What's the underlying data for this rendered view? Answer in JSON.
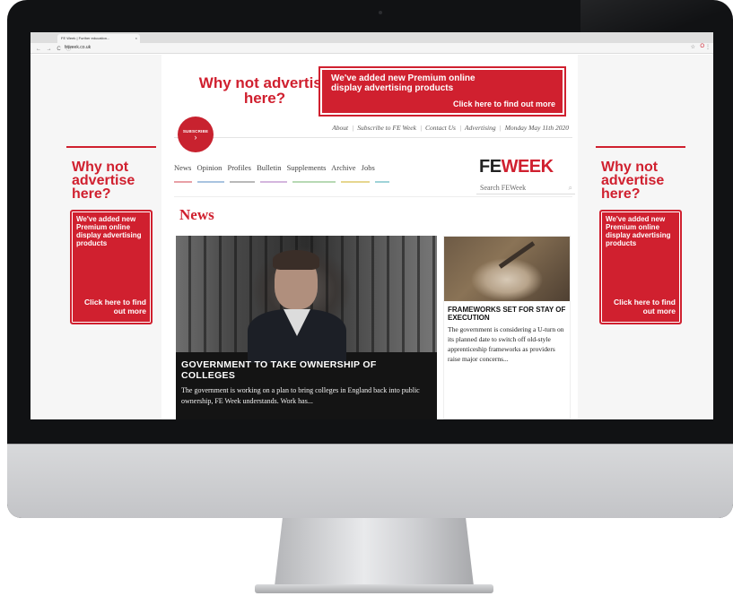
{
  "browser": {
    "tab_title": "FE Week | Further education...",
    "tab_close": "×",
    "url": "feweek.co.uk",
    "nav_controls": "← → C ⓘ",
    "star": "☆",
    "extension": "O",
    "menu": "⋮"
  },
  "ads": {
    "top": {
      "question": "Why not advertise here?",
      "text": "We've added new Premium online display advertising products",
      "cta": "Click here to find out more"
    },
    "left": {
      "question": "Why not advertise here?",
      "text": "We've added new Premium online display advertising products",
      "cta": "Click here to find out more"
    },
    "right": {
      "question": "Why not advertise here?",
      "text": "We've added new Premium online display advertising products",
      "cta": "Click here to find out more"
    }
  },
  "header": {
    "subscribe_label": "SUBSCRIBE",
    "subscribe_arrow": "›",
    "util_links": [
      "About",
      "Subscribe to FE Week",
      "Contact Us",
      "Advertising"
    ],
    "date": "Monday May 11th 2020",
    "separator": "|",
    "logo_fe": "FE",
    "logo_week": "WEEK",
    "search_placeholder": "Search FEWeek",
    "search_icon": "⌕"
  },
  "nav": {
    "items": [
      "News",
      "Opinion",
      "Profiles",
      "Bulletin",
      "Supplements",
      "Archive",
      "Jobs"
    ],
    "underline_colors": [
      "#e8a0a6",
      "#a9c4e0",
      "#b9b9b9",
      "#d4b6de",
      "#b7d9b4",
      "#e6d68f",
      "#9fd3d8"
    ]
  },
  "section": {
    "title": "News"
  },
  "stories": {
    "lead": {
      "headline": "GOVERNMENT TO TAKE OWNERSHIP OF COLLEGES",
      "summary": "The government is working on a plan to bring colleges in England back into public ownership, FE Week understands. Work has..."
    },
    "secondary": {
      "headline": "FRAMEWORKS SET FOR STAY OF EXECUTION",
      "summary": "The government is considering a U-turn on its planned date to switch off old-style apprenticeship frameworks as providers raise major concerns..."
    }
  },
  "colors": {
    "brand_red": "#d0202f",
    "bezel": "#111214",
    "chin": "#c9cacd"
  }
}
